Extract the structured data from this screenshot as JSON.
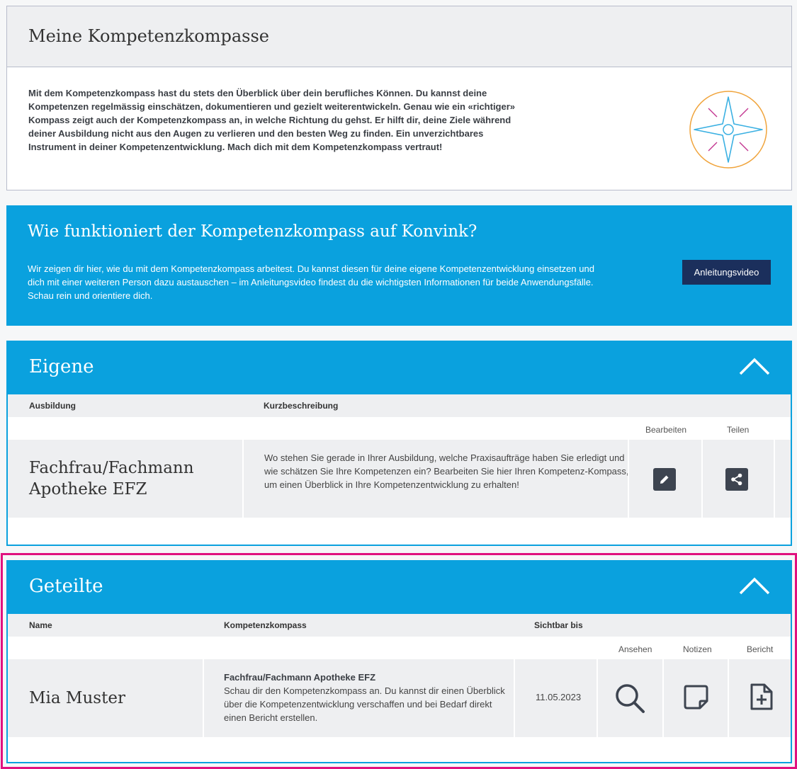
{
  "intro": {
    "title": "Meine Kompetenzkompasse",
    "text": "Mit dem Kompetenzkompass hast du stets den Überblick über dein berufliches Können. Du kannst deine Kompetenzen regelmässig einschätzen, dokumentieren und gezielt weiterentwickeln. Genau wie ein «richtiger» Kompass zeigt auch der Kompetenzkompass an, in welche Richtung du gehst. Er hilft dir, deine Ziele während deiner Ausbildung nicht aus den Augen zu verlieren und den besten Weg zu finden. Ein unverzichtbares Instrument in deiner Kompetenzentwicklung. Mach dich mit dem Kompetenzkompass vertraut!",
    "icon": "compass-icon"
  },
  "banner": {
    "title": "Wie funktioniert der Kompetenzkompass auf Konvink?",
    "text": "Wir zeigen dir hier, wie du mit dem Kompetenzkompass arbeitest. Du kannst diesen für deine eigene Kompetenzentwicklung einsetzen und dich mit einer weiteren Person dazu austauschen – im Anleitungsvideo findest du die wichtigsten Informationen für beide Anwendungsfälle. Schau rein und orientiere dich.",
    "button_label": "Anleitungsvideo"
  },
  "own": {
    "title": "Eigene",
    "col_training": "Ausbildung",
    "col_description": "Kurzbeschreibung",
    "action_edit": "Bearbeiten",
    "action_share": "Teilen",
    "rows": [
      {
        "training": "Fachfrau/Fachmann Apotheke EFZ",
        "description": "Wo stehen Sie gerade in Ihrer Ausbildung, welche Praxisaufträge haben Sie erledigt und wie schätzen Sie Ihre Kompetenzen ein? Bearbeiten Sie hier Ihren Kompetenz-Kompass, um einen Überblick in Ihre Kompetenzentwicklung zu erhalten!"
      }
    ]
  },
  "shared": {
    "title": "Geteilte",
    "col_name": "Name",
    "col_compass": "Kompetenzkompass",
    "col_visible": "Sichtbar bis",
    "action_view": "Ansehen",
    "action_notes": "Notizen",
    "action_report": "Bericht",
    "rows": [
      {
        "name": "Mia Muster",
        "compass_title": "Fachfrau/Fachmann Apotheke EFZ",
        "compass_text": "Schau dir den Kompetenzkompass an. Du kannst dir einen Überblick über die Kompetenzentwicklung verschaffen und bei Bedarf direkt einen Bericht erstellen.",
        "visible_until": "11.05.2023"
      }
    ]
  },
  "colors": {
    "accent_blue": "#0aa1de",
    "dark_navy": "#1b2f5c",
    "highlight_pink": "#e0117f",
    "icon_dark": "#3d4450"
  }
}
